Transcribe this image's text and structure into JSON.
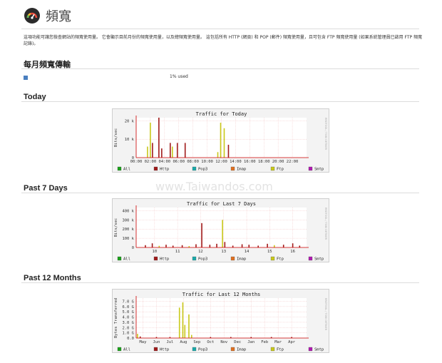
{
  "header": {
    "title": "頻寬",
    "icon": "gauge-icon"
  },
  "description": "這項功能可讓您檢查網站的頻寬使用量。 它會顯示目前月份的頻寬使用量，以及總頻寬使用量。 這包括所有 HTTP (網頁) 和 POP (郵件) 頻寬使用量，且可包含 FTP 頻寬使用量 (如果系統管理員已啟用 FTP 頻寬記錄)。",
  "monthly": {
    "title": "每月頻寬傳輸",
    "used_text": "1% used",
    "used_fraction": 0.01
  },
  "watermark": "www.Taiwandos.com",
  "colors": {
    "all": "#1aa01a",
    "http": "#a01a1a",
    "pop3": "#1aaaaa",
    "imap": "#e07020",
    "ftp": "#c8c81a",
    "smtp": "#b01ab0"
  },
  "legend": [
    "All",
    "Http",
    "Pop3",
    "Imap",
    "Ftp",
    "Smtp"
  ],
  "side_label": "RRDTOOL / TOBI OETIKER",
  "sections": [
    {
      "title": "Today",
      "chart_title": "Traffic for Today"
    },
    {
      "title": "Past 7 Days",
      "chart_title": "Traffic for Last 7 Days"
    },
    {
      "title": "Past 12 Months",
      "chart_title": "Traffic for Last 12 Months"
    }
  ],
  "chart_data": [
    {
      "type": "bar",
      "title": "Traffic for Today",
      "ylabel": "Bits/sec",
      "xticks": [
        "00:00",
        "02:00",
        "04:00",
        "06:00",
        "08:00",
        "10:00",
        "12:00",
        "14:00",
        "16:00",
        "18:00",
        "20:00",
        "22:00"
      ],
      "yticks": [
        "0",
        "10 k",
        "20 k"
      ],
      "ylim": [
        0,
        30
      ],
      "x_range": [
        0,
        24
      ],
      "bars": [
        {
          "x": 1.6,
          "v": 6,
          "s": "ftp"
        },
        {
          "x": 2.0,
          "v": 19,
          "s": "ftp"
        },
        {
          "x": 2.3,
          "v": 8,
          "s": "http"
        },
        {
          "x": 3.2,
          "v": 22,
          "s": "http"
        },
        {
          "x": 3.6,
          "v": 5,
          "s": "http"
        },
        {
          "x": 4.8,
          "v": 8,
          "s": "http"
        },
        {
          "x": 5.1,
          "v": 6,
          "s": "ftp"
        },
        {
          "x": 5.8,
          "v": 8,
          "s": "http"
        },
        {
          "x": 6.9,
          "v": 8,
          "s": "http"
        },
        {
          "x": 11.5,
          "v": 3,
          "s": "ftp"
        },
        {
          "x": 11.9,
          "v": 19,
          "s": "ftp"
        },
        {
          "x": 12.4,
          "v": 16,
          "s": "ftp"
        },
        {
          "x": 13.0,
          "v": 7,
          "s": "http"
        }
      ]
    },
    {
      "type": "bar",
      "title": "Traffic for Last 7 Days",
      "ylabel": "Bits/sec",
      "xticks": [
        "10",
        "11",
        "12",
        "13",
        "14",
        "15",
        "16"
      ],
      "yticks": [
        "0",
        "100 k",
        "200 k",
        "300 k",
        "400 k"
      ],
      "ylim": [
        0,
        440
      ],
      "x_range": [
        9.2,
        16.6
      ],
      "bars": [
        {
          "x": 9.6,
          "v": 25,
          "s": "http"
        },
        {
          "x": 9.9,
          "v": 45,
          "s": "http"
        },
        {
          "x": 10.2,
          "v": 18,
          "s": "ftp"
        },
        {
          "x": 10.5,
          "v": 30,
          "s": "http"
        },
        {
          "x": 10.8,
          "v": 20,
          "s": "http"
        },
        {
          "x": 11.2,
          "v": 25,
          "s": "http"
        },
        {
          "x": 11.5,
          "v": 15,
          "s": "ftp"
        },
        {
          "x": 11.8,
          "v": 35,
          "s": "http"
        },
        {
          "x": 12.05,
          "v": 265,
          "s": "http"
        },
        {
          "x": 12.4,
          "v": 30,
          "s": "http"
        },
        {
          "x": 12.7,
          "v": 40,
          "s": "http"
        },
        {
          "x": 12.95,
          "v": 300,
          "s": "ftp"
        },
        {
          "x": 13.05,
          "v": 60,
          "s": "http"
        },
        {
          "x": 13.4,
          "v": 20,
          "s": "http"
        },
        {
          "x": 13.8,
          "v": 35,
          "s": "http"
        },
        {
          "x": 14.1,
          "v": 30,
          "s": "http"
        },
        {
          "x": 14.5,
          "v": 20,
          "s": "http"
        },
        {
          "x": 14.9,
          "v": 40,
          "s": "http"
        },
        {
          "x": 15.2,
          "v": 25,
          "s": "ftp"
        },
        {
          "x": 15.6,
          "v": 30,
          "s": "http"
        },
        {
          "x": 16.0,
          "v": 45,
          "s": "http"
        },
        {
          "x": 16.3,
          "v": 20,
          "s": "http"
        }
      ]
    },
    {
      "type": "bar",
      "title": "Traffic for Last 12 Months",
      "ylabel": "Bytes Transferred",
      "xticks": [
        "May",
        "Jun",
        "Jul",
        "Aug",
        "Sep",
        "Oct",
        "Nov",
        "Dec",
        "Jan",
        "Feb",
        "Mar",
        "Apr"
      ],
      "yticks": [
        "0.0",
        "1.0 G",
        "2.0 G",
        "3.0 G",
        "4.0 G",
        "5.0 G",
        "6.0 G",
        "7.0 G"
      ],
      "ylim": [
        0,
        7.6
      ],
      "x_range": [
        0,
        12.6
      ],
      "bars": [
        {
          "x": 0.1,
          "v": 0.8,
          "s": "ftp"
        },
        {
          "x": 0.3,
          "v": 0.3,
          "s": "http"
        },
        {
          "x": 3.2,
          "v": 5.8,
          "s": "ftp"
        },
        {
          "x": 3.45,
          "v": 6.8,
          "s": "ftp"
        },
        {
          "x": 3.6,
          "v": 2.5,
          "s": "ftp"
        },
        {
          "x": 3.9,
          "v": 4.5,
          "s": "ftp"
        },
        {
          "x": 4.1,
          "v": 0.6,
          "s": "ftp"
        },
        {
          "x": 1.5,
          "v": 0.2,
          "s": "http"
        },
        {
          "x": 2.5,
          "v": 0.2,
          "s": "http"
        },
        {
          "x": 5.5,
          "v": 0.2,
          "s": "http"
        },
        {
          "x": 7.0,
          "v": 0.2,
          "s": "http"
        },
        {
          "x": 8.5,
          "v": 0.2,
          "s": "http"
        },
        {
          "x": 10.0,
          "v": 0.2,
          "s": "http"
        },
        {
          "x": 11.5,
          "v": 0.2,
          "s": "http"
        }
      ]
    }
  ]
}
